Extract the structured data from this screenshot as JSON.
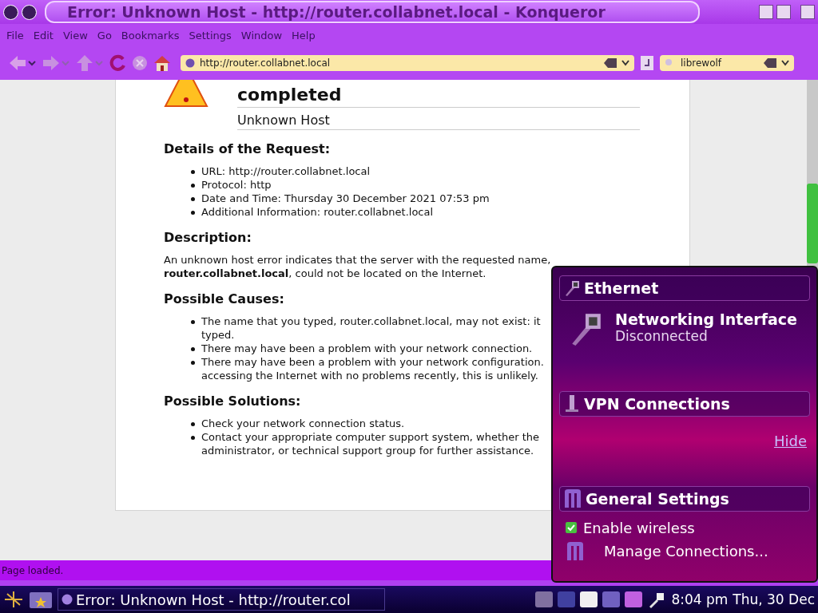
{
  "window": {
    "title": "Error: Unknown Host - http://router.collabnet.local - Konqueror"
  },
  "menu": [
    "File",
    "Edit",
    "View",
    "Go",
    "Bookmarks",
    "Settings",
    "Window",
    "Help"
  ],
  "toolbar": {
    "url": "http://router.collabnet.local",
    "search": "librewolf"
  },
  "page": {
    "heading_lines": [
      "completed"
    ],
    "subtitle": "Unknown Host",
    "sections": [
      {
        "kind": "list",
        "title": "Details of the Request:",
        "items": [
          {
            "lines": [
              "URL: http://router.collabnet.local"
            ]
          },
          {
            "lines": [
              "Protocol: http"
            ]
          },
          {
            "lines": [
              "Date and Time: Thursday 30 December 2021 07:53 pm"
            ]
          },
          {
            "lines": [
              "Additional Information: router.collabnet.local"
            ]
          }
        ]
      },
      {
        "kind": "paragraph",
        "title": "Description:",
        "lines": [
          "An unknown host error indicates that the server with the requested name,",
          "**router.collabnet.local**, could not be located on the Internet."
        ]
      },
      {
        "kind": "list",
        "title": "Possible Causes:",
        "items": [
          {
            "lines": [
              "The name that you typed, router.collabnet.local, may not exist: it",
              "typed."
            ]
          },
          {
            "lines": [
              "There may have been a problem with your network connection."
            ]
          },
          {
            "lines": [
              "There may have been a problem with your network configuration.",
              "accessing the Internet with no problems recently, this is unlikely."
            ]
          }
        ]
      },
      {
        "kind": "list",
        "title": "Possible Solutions:",
        "items": [
          {
            "lines": [
              "Check your network connection status."
            ]
          },
          {
            "lines": [
              "Contact your appropriate computer support system, whether the",
              "administrator, or technical support group for further assistance."
            ]
          }
        ]
      }
    ]
  },
  "status_bar": "Page loaded.",
  "network_popup": {
    "sections": [
      {
        "kind": "device",
        "title": "Ethernet",
        "name": "Networking Interface",
        "status": "Disconnected"
      },
      {
        "kind": "vpn",
        "title": "VPN Connections",
        "link": "Hide"
      },
      {
        "kind": "settings",
        "title": "General Settings",
        "checkbox": {
          "label": "Enable wireless",
          "checked": true
        },
        "button": "Manage Connections..."
      }
    ]
  },
  "taskbar": {
    "task": "Error: Unknown Host - http://router.col",
    "time": "8:04 pm",
    "date": "Thu, 30 Dec"
  }
}
